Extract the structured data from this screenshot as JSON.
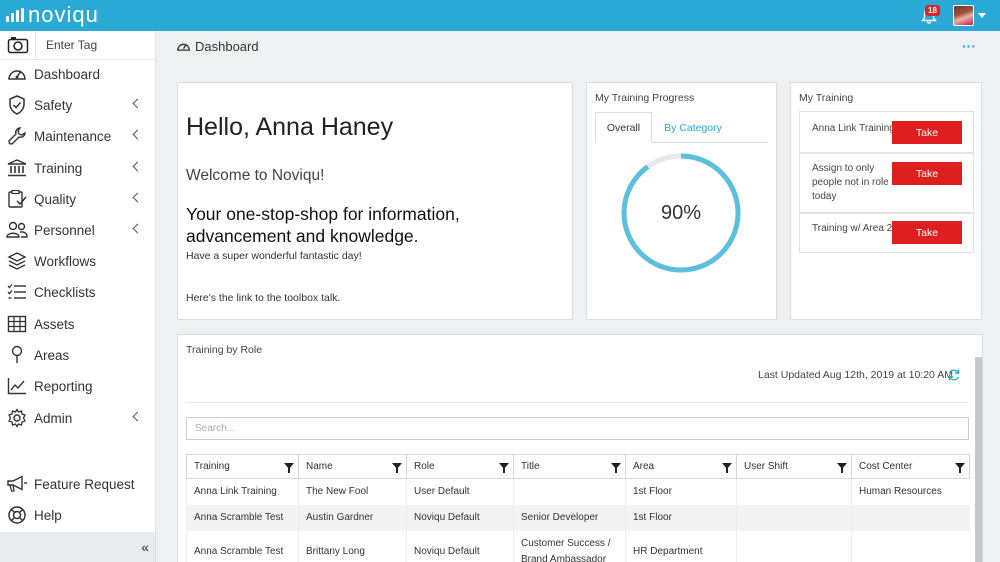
{
  "topbar": {
    "logo_text": "noviqu",
    "notification_count": "18",
    "colors": {
      "bar": "#2aa9d4",
      "badge": "#d9262c"
    }
  },
  "sidebar": {
    "tag_placeholder": "Enter Tag",
    "items": [
      {
        "label": "Dashboard",
        "icon": "gauge-icon",
        "chevron": false
      },
      {
        "label": "Safety",
        "icon": "shield-check-icon",
        "chevron": true
      },
      {
        "label": "Maintenance",
        "icon": "wrench-icon",
        "chevron": true
      },
      {
        "label": "Training",
        "icon": "institution-icon",
        "chevron": true
      },
      {
        "label": "Quality",
        "icon": "clipboard-check-icon",
        "chevron": true
      },
      {
        "label": "Personnel",
        "icon": "users-icon",
        "chevron": true
      },
      {
        "label": "Workflows",
        "icon": "layers-icon",
        "chevron": false
      },
      {
        "label": "Checklists",
        "icon": "checklist-icon",
        "chevron": false
      },
      {
        "label": "Assets",
        "icon": "table-grid-icon",
        "chevron": false
      },
      {
        "label": "Areas",
        "icon": "map-pin-icon",
        "chevron": false
      },
      {
        "label": "Reporting",
        "icon": "line-chart-icon",
        "chevron": false
      },
      {
        "label": "Admin",
        "icon": "gear-icon",
        "chevron": true
      }
    ],
    "bottom_items": [
      {
        "label": "Feature Request",
        "icon": "megaphone-icon"
      },
      {
        "label": "Help",
        "icon": "lifebuoy-icon"
      }
    ],
    "collapse_glyph": "«"
  },
  "page": {
    "title": "Dashboard",
    "more_glyph": "···"
  },
  "welcome": {
    "greeting": "Hello, Anna Haney",
    "welcome": "Welcome to Noviqu!",
    "tagline": "Your one-stop-shop for information, advancement and knowledge.",
    "day_message": "Have a super wonderful fantastic day!",
    "link_text": "Here's the link to the toolbox talk."
  },
  "progress": {
    "title": "My Training Progress",
    "tabs": [
      "Overall",
      "By Category"
    ],
    "active_tab": "Overall",
    "percent_label": "90%",
    "percent": 0.9,
    "ring_color": "#5bc0de"
  },
  "my_training": {
    "title": "My Training",
    "button_label": "Take",
    "items": [
      "Anna Link Training",
      "Assign to only people not in role today",
      "Training w/ Area 2"
    ]
  },
  "training_by_role": {
    "title": "Training by Role",
    "last_updated": "Last Updated Aug 12th, 2019 at 10:20 AM",
    "search_placeholder": "Search...",
    "columns": [
      "Training",
      "Name",
      "Role",
      "Title",
      "Area",
      "User Shift",
      "Cost Center"
    ],
    "rows": [
      [
        "Anna Link Training",
        "The New Fool",
        "User Default",
        "",
        "1st Floor",
        "",
        "Human Resources"
      ],
      [
        "Anna Scramble Test",
        "Austin Gardner",
        "Noviqu Default",
        "Senior Developer",
        "1st Floor",
        "",
        ""
      ],
      [
        "Anna Scramble Test",
        "Brittany Long",
        "Noviqu Default",
        "Customer Success / Brand Ambassador",
        "HR Department",
        "",
        ""
      ]
    ]
  }
}
